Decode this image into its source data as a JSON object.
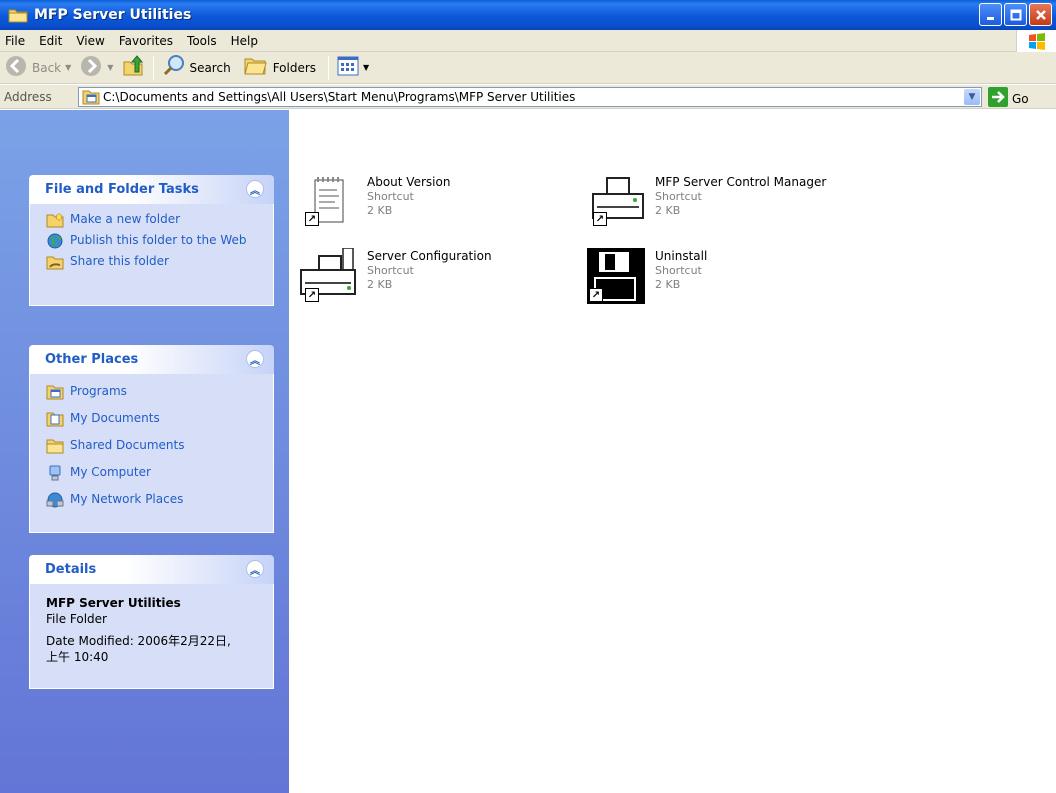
{
  "window": {
    "title": "MFP Server Utilities"
  },
  "menu": [
    "File",
    "Edit",
    "View",
    "Favorites",
    "Tools",
    "Help"
  ],
  "toolbar": {
    "back": "Back",
    "search": "Search",
    "folders": "Folders"
  },
  "address": {
    "label": "Address",
    "path": "C:\\Documents and Settings\\All Users\\Start Menu\\Programs\\MFP Server Utilities",
    "go": "Go"
  },
  "panels": {
    "tasks": {
      "title": "File and Folder Tasks",
      "items": [
        "Make a new folder",
        "Publish this folder to the Web",
        "Share this folder"
      ]
    },
    "places": {
      "title": "Other Places",
      "items": [
        "Programs",
        "My Documents",
        "Shared Documents",
        "My Computer",
        "My Network Places"
      ]
    },
    "details": {
      "title": "Details",
      "name": "MFP Server Utilities",
      "type": "File Folder",
      "modified_1": "Date Modified: 2006年2月22日,",
      "modified_2": "上午 10:40"
    }
  },
  "files": [
    {
      "name": "About Version",
      "type": "Shortcut",
      "size": "2 KB",
      "icon": "notepad-icon"
    },
    {
      "name": "MFP Server Control Manager",
      "type": "Shortcut",
      "size": "2 KB",
      "icon": "printer-icon"
    },
    {
      "name": "Server Configuration",
      "type": "Shortcut",
      "size": "2 KB",
      "icon": "printer-icon"
    },
    {
      "name": "Uninstall",
      "type": "Shortcut",
      "size": "2 KB",
      "icon": "floppy-icon"
    }
  ],
  "colors": {
    "title_bar": "#0a58d8",
    "pane_link": "#215dc6",
    "left_pane": "#7ba2e7"
  }
}
